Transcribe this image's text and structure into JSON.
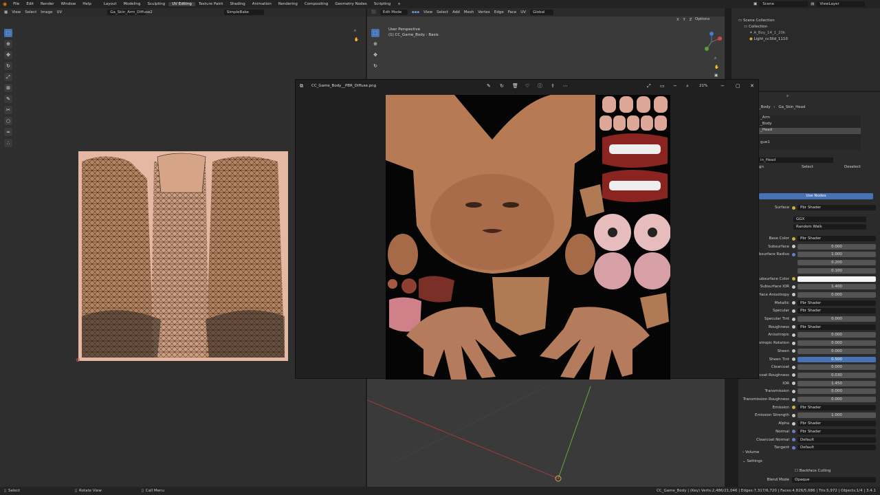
{
  "menus": [
    "File",
    "Edit",
    "Render",
    "Window",
    "Help"
  ],
  "workspaces": [
    "Layout",
    "Modeling",
    "Sculpting",
    "UV Editing",
    "Texture Paint",
    "Shading",
    "Animation",
    "Rendering",
    "Compositing",
    "Geometry Nodes",
    "Scripting"
  ],
  "active_workspace": "UV Editing",
  "scene": "Scene",
  "view_layer": "ViewLayer",
  "uv_editor": {
    "menu": [
      "View",
      "Select",
      "Image",
      "UV"
    ],
    "image_name": "Ga_Skin_Arm_Diffuse",
    "image_count": "2",
    "bake_name": "SimpleBake"
  },
  "viewport": {
    "mode": "Edit Mode",
    "menu": [
      "View",
      "Select",
      "Add",
      "Mesh",
      "Vertex",
      "Edge",
      "Face",
      "UV"
    ],
    "orientation": "Global",
    "perspective": "User Perspective",
    "object_info": "(1) CC_Game_Body : Basis",
    "options": "Options",
    "axes": "X Y Z"
  },
  "outliner": {
    "items": [
      "Scene Collection",
      "Collection",
      "A_Boy_14_1_20k",
      "Light_cc3lid_1110"
    ]
  },
  "image_viewer": {
    "filename": "CC_Game_Body__PBR_Diffuse.png",
    "zoom": "21%"
  },
  "properties": {
    "material_path": [
      "_Body",
      "Ga_Skin_Head"
    ],
    "slots": [
      "_Arm",
      "_Body",
      "_Head",
      "",
      "gue1"
    ],
    "active_slot": "_Head",
    "material_name": "in_Head",
    "assign": "gn",
    "select": "Select",
    "deselect": "Deselect",
    "use_nodes": "Use Nodes",
    "surface_label": "Surface",
    "surface_value": "Pbr Shader",
    "distribution": "GGX",
    "subsurface_method": "Random Walk",
    "rows": [
      {
        "label": "Base Color",
        "value": "Pbr Shader",
        "socket": "y",
        "kind": "link"
      },
      {
        "label": "Subsurface",
        "value": "0.000",
        "socket": "g",
        "kind": "num"
      },
      {
        "label": "Subsurface Radius",
        "value": "1.000",
        "socket": "b",
        "kind": "num"
      },
      {
        "label": "",
        "value": "0.200",
        "socket": "",
        "kind": "num"
      },
      {
        "label": "",
        "value": "0.100",
        "socket": "",
        "kind": "num"
      },
      {
        "label": "Subsurface Color",
        "value": "",
        "socket": "y",
        "kind": "color"
      },
      {
        "label": "Subsurface IOR",
        "value": "1.400",
        "socket": "g",
        "kind": "num"
      },
      {
        "label": "urface Anisotropy",
        "value": "0.000",
        "socket": "g",
        "kind": "num"
      },
      {
        "label": "Metallic",
        "value": "Pbr Shader",
        "socket": "g",
        "kind": "link"
      },
      {
        "label": "Specular",
        "value": "Pbr Shader",
        "socket": "g",
        "kind": "link"
      },
      {
        "label": "Specular Tint",
        "value": "0.000",
        "socket": "g",
        "kind": "num"
      },
      {
        "label": "Roughness",
        "value": "Pbr Shader",
        "socket": "g",
        "kind": "link"
      },
      {
        "label": "Anisotropic",
        "value": "0.000",
        "socket": "g",
        "kind": "num"
      },
      {
        "label": "isotropic Rotation",
        "value": "0.000",
        "socket": "g",
        "kind": "num"
      },
      {
        "label": "Sheen",
        "value": "0.000",
        "socket": "g",
        "kind": "num"
      },
      {
        "label": "Sheen Tint",
        "value": "0.500",
        "socket": "g",
        "kind": "num"
      },
      {
        "label": "Clearcoat",
        "value": "0.000",
        "socket": "g",
        "kind": "num"
      },
      {
        "label": "arcoat Roughness",
        "value": "0.030",
        "socket": "g",
        "kind": "num"
      },
      {
        "label": "IOR",
        "value": "1.450",
        "socket": "g",
        "kind": "num"
      },
      {
        "label": "Transmission",
        "value": "0.000",
        "socket": "g",
        "kind": "num"
      },
      {
        "label": "Transmission Roughness",
        "value": "0.000",
        "socket": "g",
        "kind": "num"
      },
      {
        "label": "Emission",
        "value": "Pbr Shader",
        "socket": "y",
        "kind": "link"
      },
      {
        "label": "Emission Strength",
        "value": "1.000",
        "socket": "g",
        "kind": "num"
      },
      {
        "label": "Alpha",
        "value": "Pbr Shader",
        "socket": "g",
        "kind": "link"
      },
      {
        "label": "Normal",
        "value": "Pbr Shader",
        "socket": "b",
        "kind": "link"
      },
      {
        "label": "Clearcoat Normal",
        "value": "Default",
        "socket": "b",
        "kind": "link"
      },
      {
        "label": "Tangent",
        "value": "Default",
        "socket": "b",
        "kind": "link"
      }
    ],
    "volume": "Volume",
    "settings": "Settings",
    "backface_culling": "Backface Culling",
    "blend_mode_label": "Blend Mode",
    "blend_mode": "Opaque"
  },
  "status": {
    "select": "Select",
    "rotate": "Rotate View",
    "menu": "Call Menu",
    "stats": "CC_Game_Body | (Key) Verts:2,486/21,046 | Edges:7,317/6,720 | Faces:4,826/5,686 | Tris:5,972 | Objects:1/4 | 3.4.1"
  }
}
